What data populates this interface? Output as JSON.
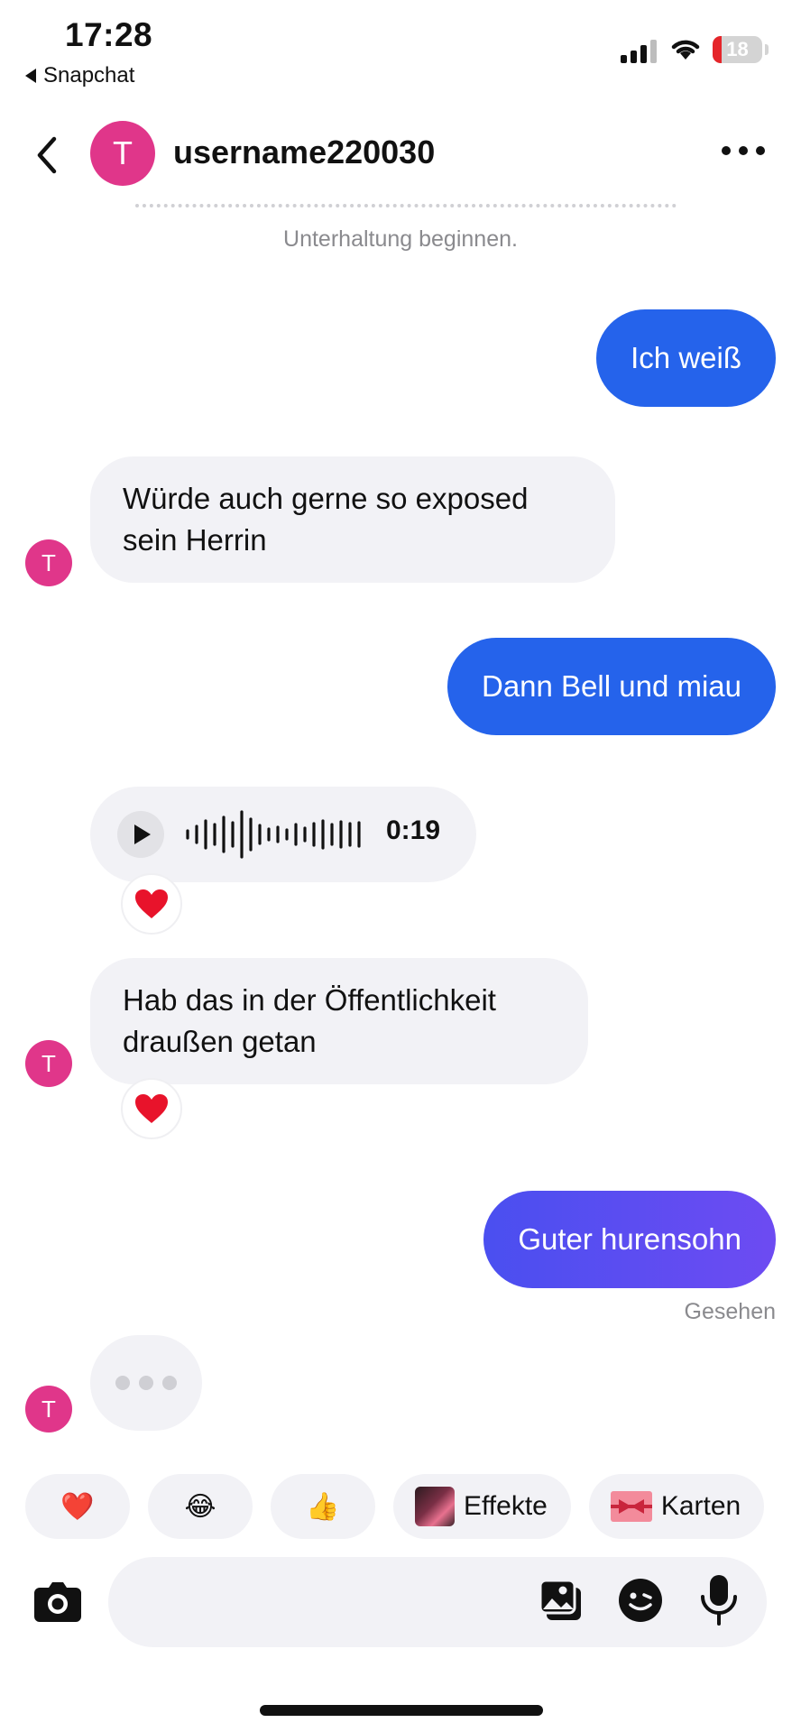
{
  "status_bar": {
    "time": "17:28",
    "back_app": "Snapchat",
    "battery_percent": "18",
    "battery_level": 0.18
  },
  "header": {
    "avatar_initial": "T",
    "username": "username220030"
  },
  "info": {
    "text": "Unterhaltung beginnen."
  },
  "messages": {
    "m1": "Ich weiß",
    "m2": "Würde auch gerne so exposed sein Herrin",
    "m3": "Dann Bell und miau",
    "m4_duration": "0:19",
    "m5": "Hab das in der Öffentlichkeit draußen getan",
    "m6": "Guter hurensohn",
    "seen": "Gesehen",
    "avatar_initial": "T",
    "reaction": "❤️"
  },
  "quick_replies": {
    "heart": "❤️",
    "laugh": "😂",
    "thumbs": "👍",
    "effects_label": "Effekte",
    "cards_label": "Karten"
  },
  "colors": {
    "outgoing_bubble": "#2563eb",
    "incoming_bubble": "#f2f2f6",
    "avatar": "#e0368a"
  }
}
